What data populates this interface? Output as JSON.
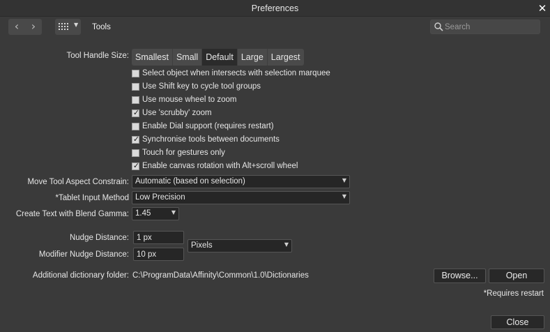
{
  "window": {
    "title": "Preferences",
    "close_glyph": "✕"
  },
  "toolbar": {
    "back_glyph": "‹",
    "forward_glyph": "›",
    "grid_caret": "▼",
    "section": "Tools",
    "search_placeholder": "Search"
  },
  "tool_handle_size": {
    "label": "Tool Handle Size:",
    "options": [
      "Smallest",
      "Small",
      "Default",
      "Large",
      "Largest"
    ],
    "selected": "Default"
  },
  "checkboxes": [
    {
      "label": "Select object when intersects with selection marquee",
      "checked": false
    },
    {
      "label": "Use Shift key to cycle tool groups",
      "checked": false
    },
    {
      "label": "Use mouse wheel to zoom",
      "checked": false
    },
    {
      "label": "Use 'scrubby' zoom",
      "checked": true
    },
    {
      "label": "Enable Dial support (requires restart)",
      "checked": false
    },
    {
      "label": "Synchronise tools between documents",
      "checked": true
    },
    {
      "label": "Touch for gestures only",
      "checked": false
    },
    {
      "label": "Enable canvas rotation with Alt+scroll wheel",
      "checked": true
    }
  ],
  "check_glyph": "✓",
  "caret_glyph": "▼",
  "move_tool": {
    "label": "Move Tool Aspect Constrain:",
    "value": "Automatic (based on selection)"
  },
  "tablet_input": {
    "label": "*Tablet Input Method",
    "value": "Low Precision"
  },
  "blend_gamma": {
    "label": "Create Text with Blend Gamma:",
    "value": "1.45"
  },
  "nudge": {
    "label": "Nudge Distance:",
    "value": "1 px"
  },
  "modifier_nudge": {
    "label": "Modifier Nudge Distance:",
    "value": "10 px"
  },
  "units": {
    "value": "Pixels"
  },
  "dictionary": {
    "label": "Additional dictionary folder:",
    "path": "C:\\ProgramData\\Affinity\\Common\\1.0\\Dictionaries",
    "browse_label": "Browse...",
    "open_label": "Open"
  },
  "restart_note": "*Requires restart",
  "close_label": "Close",
  "colors": {
    "background": "#3a3a3a",
    "titlebar": "#333333",
    "field": "#262626",
    "checkbox": "#dadada",
    "segment_active": "#2b2b2b"
  }
}
